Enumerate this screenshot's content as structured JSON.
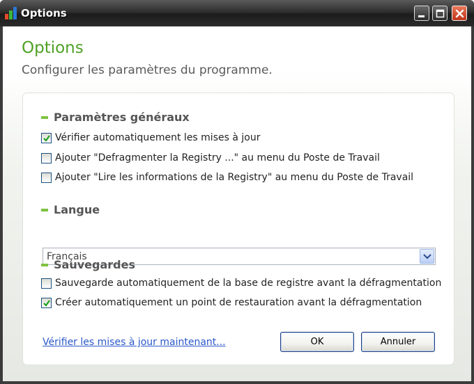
{
  "window": {
    "title": "Options"
  },
  "header": {
    "title": "Options",
    "subtitle": "Configurer les paramètres du programme."
  },
  "general": {
    "heading": "Paramètres généraux",
    "options": [
      {
        "label": "Vérifier automatiquement les mises à jour",
        "checked": true
      },
      {
        "label": "Ajouter \"Defragmenter la Registry ...\" au menu du Poste de Travail",
        "checked": false
      },
      {
        "label": "Ajouter \"Lire les informations de la Registry\" au menu du Poste de Travail",
        "checked": false
      }
    ]
  },
  "language": {
    "heading": "Langue",
    "selected": "Français"
  },
  "backups": {
    "heading": "Sauvegardes",
    "options": [
      {
        "label": "Sauvegarde automatiquement de la base de registre avant la défragmentation",
        "checked": false
      },
      {
        "label": "Créer automatiquement un point de restauration avant la défragmentation",
        "checked": true
      }
    ]
  },
  "footer": {
    "update_link": "Vérifier les mises à jour maintenant...",
    "ok_label": "OK",
    "cancel_label": "Annuler"
  },
  "colors": {
    "accent_green": "#4fa125",
    "section_bar": "#7fc241",
    "link_blue": "#2a57c9"
  },
  "icons": {
    "app": "bar-chart-icon",
    "checkmark": "check-icon",
    "dropdown": "chevron-down-icon"
  }
}
